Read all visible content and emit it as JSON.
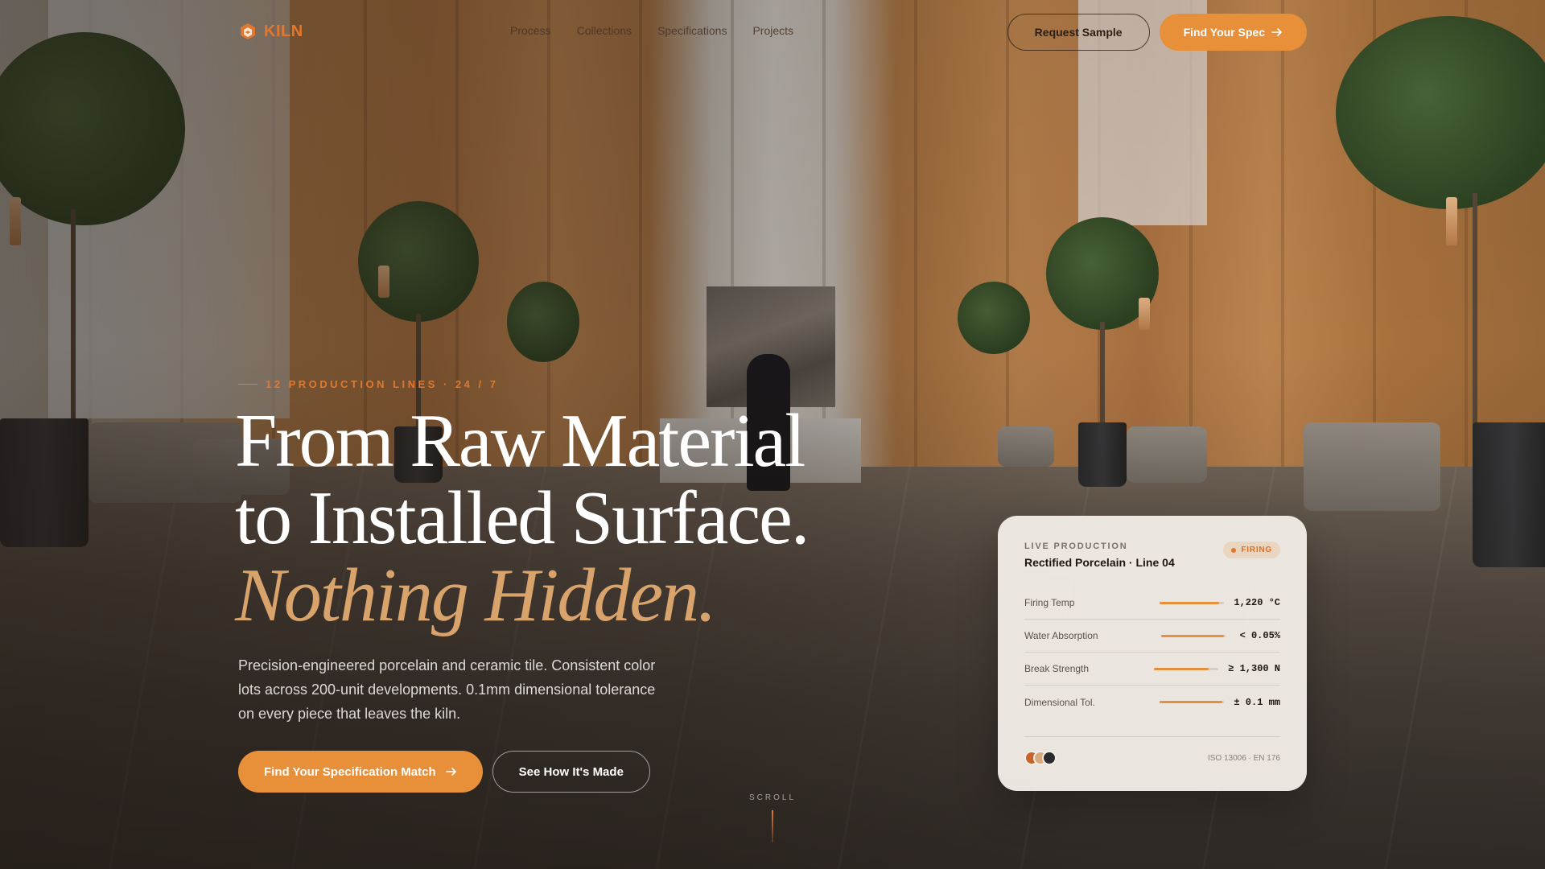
{
  "brand": {
    "name": "KILN",
    "color": "#e2782e"
  },
  "nav": {
    "links": [
      "Process",
      "Collections",
      "Specifications",
      "Projects"
    ],
    "request_sample": "Request Sample",
    "find_spec": "Find Your Spec"
  },
  "hero": {
    "eyebrow": "12 PRODUCTION LINES · 24 / 7",
    "headline_line1": "From Raw Material",
    "headline_line2": "to Installed Surface.",
    "headline_accent": "Nothing Hidden.",
    "subcopy": "Precision-engineered porcelain and ceramic tile. Consistent color lots across 200-unit developments. 0.1mm dimensional tolerance on every piece that leaves the kiln.",
    "cta_primary": "Find Your Specification Match",
    "cta_secondary": "See How It's Made",
    "scroll_label": "SCROLL"
  },
  "card": {
    "kicker": "LIVE PRODUCTION",
    "title": "Rectified Porcelain · Line 04",
    "status": "FIRING",
    "metrics": [
      {
        "label": "Firing Temp",
        "value": "1,220 °C",
        "level": 0.92
      },
      {
        "label": "Water Absorption",
        "value": "< 0.05%",
        "level": 0.98
      },
      {
        "label": "Break Strength",
        "value": "≥ 1,300 N",
        "level": 0.85
      },
      {
        "label": "Dimensional Tol.",
        "value": "± 0.1 mm",
        "level": 0.97
      }
    ],
    "swatches": [
      "#c8632a",
      "#d9a87c",
      "#2b2b2e"
    ],
    "certification": "ISO 13006 · EN 176"
  },
  "colors": {
    "accent": "#e88f3a",
    "accent_text": "#d9a36c"
  }
}
